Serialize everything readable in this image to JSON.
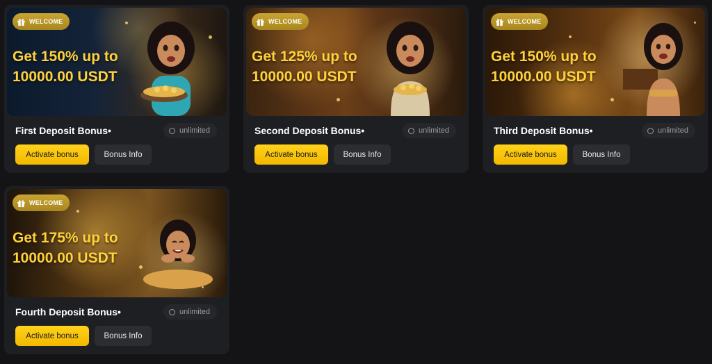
{
  "cards": [
    {
      "badge": "WELCOME",
      "headline": "Get 150% up to\n10000.00 USDT",
      "title": "First Deposit Bonus•",
      "limit": "unlimited",
      "activate_label": "Activate bonus",
      "info_label": "Bonus Info"
    },
    {
      "badge": "WELCOME",
      "headline": "Get 125% up to\n10000.00 USDT",
      "title": "Second Deposit Bonus•",
      "limit": "unlimited",
      "activate_label": "Activate bonus",
      "info_label": "Bonus Info"
    },
    {
      "badge": "WELCOME",
      "headline": "Get 150% up to\n10000.00 USDT",
      "title": "Third Deposit Bonus•",
      "limit": "unlimited",
      "activate_label": "Activate bonus",
      "info_label": "Bonus Info"
    },
    {
      "badge": "WELCOME",
      "headline": "Get 175% up to\n10000.00 USDT",
      "title": "Fourth Deposit Bonus•",
      "limit": "unlimited",
      "activate_label": "Activate bonus",
      "info_label": "Bonus Info"
    }
  ],
  "colors": {
    "background": "#141416",
    "card": "#1e1f22",
    "accent_yellow": "#ffd21a",
    "headline_gold": "#ffd23a",
    "badge_gold": "#c9a431"
  },
  "icons": {
    "badge": "gift-icon",
    "limit": "circle-icon"
  }
}
